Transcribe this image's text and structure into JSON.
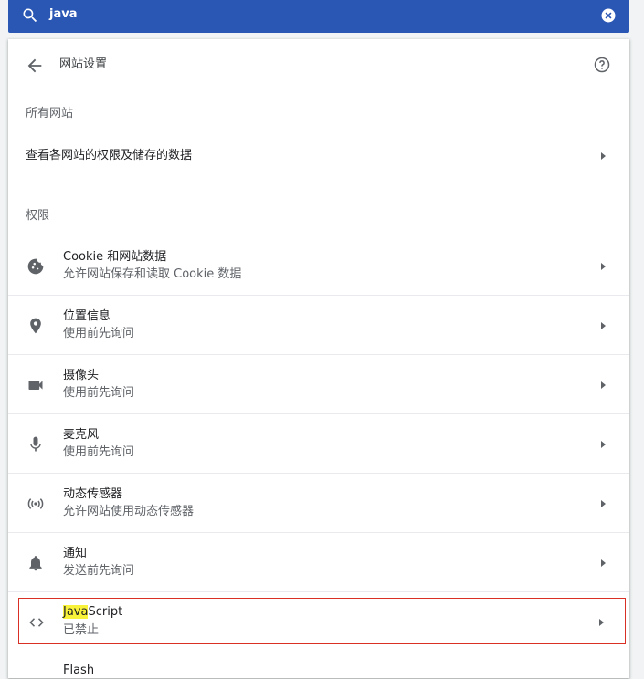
{
  "search": {
    "query": "java",
    "icon": "search-icon",
    "clear_icon": "close-circle-icon"
  },
  "header": {
    "title": "网站设置",
    "back_icon": "arrow-back-icon",
    "help_icon": "help-icon"
  },
  "all_sites": {
    "section_label": "所有网站",
    "link": "查看各网站的权限及储存的数据"
  },
  "permissions": {
    "section_label": "权限",
    "items": [
      {
        "title": "Cookie 和网站数据",
        "sub": "允许网站保存和读取 Cookie 数据",
        "icon": "cookie-icon"
      },
      {
        "title": "位置信息",
        "sub": "使用前先询问",
        "icon": "location-icon"
      },
      {
        "title": "摄像头",
        "sub": "使用前先询问",
        "icon": "camera-icon"
      },
      {
        "title": "麦克风",
        "sub": "使用前先询问",
        "icon": "microphone-icon"
      },
      {
        "title": "动态传感器",
        "sub": "允许网站使用动态传感器",
        "icon": "sensors-icon"
      },
      {
        "title": "通知",
        "sub": "发送前先询问",
        "icon": "bell-icon"
      }
    ],
    "javascript": {
      "title_highlight": "Java",
      "title_rest": "Script",
      "sub": "已禁止",
      "icon": "code-icon"
    },
    "next_partial": "Flash"
  },
  "colors": {
    "topbar": "#2a56b4",
    "highlight": "#f9f23a",
    "outline": "#d93025"
  }
}
